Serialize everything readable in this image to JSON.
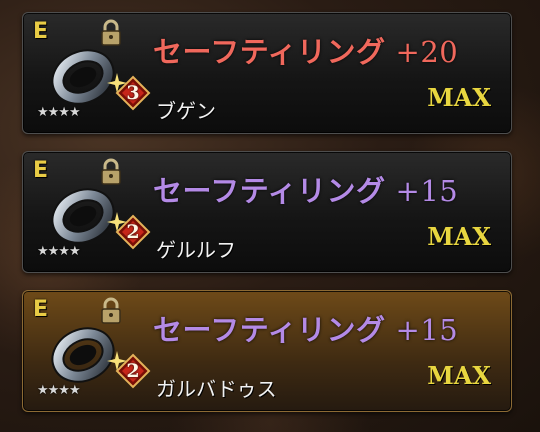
{
  "items": [
    {
      "grade": "E",
      "level_badge": "3",
      "rarity_stars": "★★★★",
      "name": "セーフティリング",
      "plus": "+20",
      "name_color": "#f0685c",
      "owner": "ブゲン",
      "status": "MAX",
      "selected": false
    },
    {
      "grade": "E",
      "level_badge": "2",
      "rarity_stars": "★★★★",
      "name": "セーフティリング",
      "plus": "+15",
      "name_color": "#b48ae6",
      "owner": "ゲルルフ",
      "status": "MAX",
      "selected": false
    },
    {
      "grade": "E",
      "level_badge": "2",
      "rarity_stars": "★★★★",
      "name": "セーフティリング",
      "plus": "+15",
      "name_color": "#b48ae6",
      "owner": "ガルバドゥス",
      "status": "MAX",
      "selected": true
    }
  ],
  "icons": {
    "item": "ring-icon",
    "lock": "lock-icon",
    "badge": "red-diamond-badge-icon",
    "sparkle": "sparkle-icon"
  },
  "colors": {
    "grade": "#e9cc45",
    "max": "#e8d640",
    "selected_card": "#6e4a18"
  }
}
